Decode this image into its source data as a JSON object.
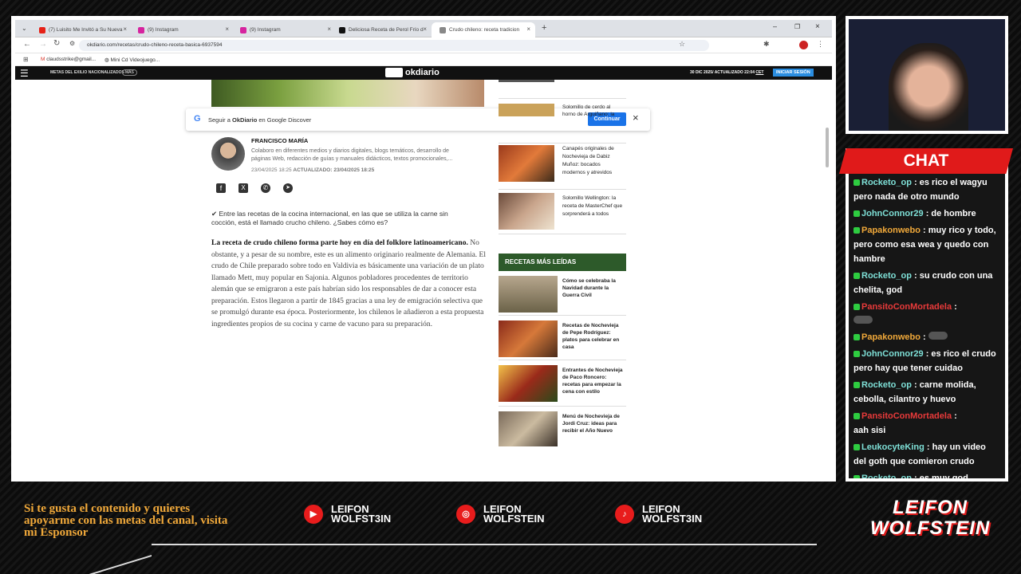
{
  "tabs": [
    {
      "label": "(7) Luisito Me Invitó a Su Nueva",
      "icon": "youtube-icon",
      "color": "#e62117"
    },
    {
      "label": "(9) Instagram",
      "icon": "instagram-icon",
      "color": "#d6249f"
    },
    {
      "label": "(9) Instagram",
      "icon": "instagram-icon",
      "color": "#d6249f"
    },
    {
      "label": "Deliciosa Receta de Perol Frío d",
      "icon": "tiktok-icon",
      "color": "#111111"
    },
    {
      "label": "Crudo chileno: receta tradicion",
      "icon": "okdiario-icon",
      "color": "#888888"
    }
  ],
  "address": "okdiario.com/recetas/crudo-chileno-receta-basica-6937594",
  "bookmarks": [
    "claudsstrike@gmail...",
    "Mini Cd Videojuego..."
  ],
  "site": {
    "menu_text": "METAS DEL EXILIO NACIONALIZADOS",
    "more": "MÁS",
    "logo": "okdiario",
    "date": "30 DIC 2025/",
    "updated": "ACTUALIZADO 22:04",
    "tz": "CET",
    "login": "INICIAR SESIÓN"
  },
  "discover": {
    "text_pre": "Seguir a ",
    "brand": "OkDiario",
    "text_post": " en Google Discover",
    "button": "Continuar"
  },
  "author": {
    "name": "FRANCISCO MARÍA",
    "bio": "Colaboro en diferentes medios y diarios digitales, blogs temáticos, desarrollo de páginas Web, redacción de guías y manuales didácticos, textos promocionales,...",
    "dates": "23/04/2025 18:25",
    "updated_label": "ACTUALIZADO: 23/04/2025 18:25"
  },
  "lead": "✔ Entre las recetas de la cocina internacional, en las que se utiliza la carne sin cocción, está el llamado crucho chileno. ¿Sabes cómo es?",
  "body": {
    "bold": "La receta de crudo chileno forma parte hoy en día del folklore latinoamericano.",
    "text": " No obstante, y a pesar de su nombre, este es un alimento originario realmente de Alemania. El crudo de Chile preparado sobre todo en Valdivia es básicamente una variación de un plato llamado Mett, muy popular en Sajonia. Algunos pobladores procedentes de territorio alemán que se emigraron a este país habrían sido los responsables de dar a conocer esta preparación. Estos llegaron a partir de 1845 gracias a una ley de emigración selectiva que se promulgó durante esa época. Posteriormente, los chilenos le añadieron a esta propuesta ingredientes propios de su cocina y carne de vacuno para su preparación."
  },
  "sidebar_top": [
    {
      "title": "Solomillo de cerdo al horno de Arguiñano: la"
    },
    {
      "title": "Canapés originales de Nochevieja de Dabiz Muñoz: bocados modernos y atrevidos"
    },
    {
      "title": "Solomillo Wellington: la receta de MasterChef que sorprenderá a todos"
    }
  ],
  "most_read_title": "RECETAS MÁS LEÍDAS",
  "most_read": [
    {
      "title": "Cómo se celebraba la Navidad durante la Guerra Civil"
    },
    {
      "title": "Recetas de Nochevieja de Pepe Rodríguez: platos para celebrar en casa"
    },
    {
      "title": "Entrantes de Nochevieja de Paco Roncero: recetas para empezar la cena con estilo"
    },
    {
      "title": "Menú de Nochevieja de Jordi Cruz: ideas para recibir el Año Nuevo"
    }
  ],
  "chat_title": "CHAT",
  "chat": [
    {
      "user": "Rocketo_op",
      "color": "cyan",
      "text": ": es rico el wagyu pero nada de otro mundo"
    },
    {
      "user": "JohnConnor29",
      "color": "cyan",
      "text": ": de hombre"
    },
    {
      "user": "Papakonwebo",
      "color": "orange",
      "text": ": muy rico y todo, pero como esa wea y quedo con hambre"
    },
    {
      "user": "Rocketo_op",
      "color": "cyan",
      "text": ": su crudo con una chelita, god"
    },
    {
      "user": "PansitoConMortadela",
      "color": "red",
      "text": ":"
    },
    {
      "user": "Papakonwebo",
      "color": "orange",
      "text": ":"
    },
    {
      "user": "JohnConnor29",
      "color": "cyan",
      "text": ": es rico el crudo pero hay que tener cuidao"
    },
    {
      "user": "Rocketo_op",
      "color": "cyan",
      "text": ": carne molida, cebolla, cilantro y huevo"
    },
    {
      "user": "PansitoConMortadela",
      "color": "red",
      "text": ":"
    },
    {
      "user": "",
      "color": "cyan",
      "text": "aah sisi"
    },
    {
      "user": "LeukocyteKing",
      "color": "cyan",
      "text": ": hay un video del goth que comieron crudo"
    },
    {
      "user": "Rocketo_op",
      "color": "cyan",
      "text": ": es muy god"
    }
  ],
  "sponsor_text": "Si te gusta el contenido y quieres apoyarme con las metas del canal, visita mi Esponsor",
  "socials": [
    {
      "line1": "LEIFON",
      "line2": "WOLFST3IN",
      "icon": "youtube-icon"
    },
    {
      "line1": "LEIFON",
      "line2": "WOLFSTEIN",
      "icon": "instagram-icon"
    },
    {
      "line1": "LEIFON",
      "line2": "WOLFST3IN",
      "icon": "tiktok-icon"
    }
  ],
  "brand_logo": {
    "line1": "LEIFON",
    "line2": "WOLFSTEIN"
  },
  "colors": {
    "accent": "#e01a1a",
    "sidebar_green": "#2d5a2a",
    "ok_blue": "#1a73e8"
  }
}
